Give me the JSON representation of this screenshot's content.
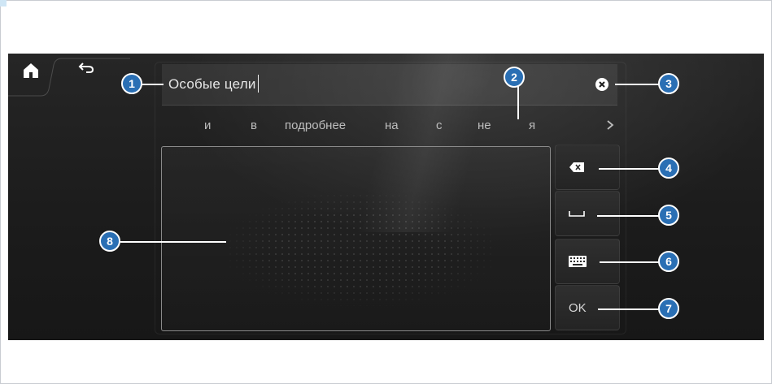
{
  "text_field": {
    "value": "Особые цели"
  },
  "suggestions": [
    {
      "label": "и"
    },
    {
      "label": "в"
    },
    {
      "label": "подробнее"
    },
    {
      "label": "на"
    },
    {
      "label": "с"
    },
    {
      "label": "не"
    },
    {
      "label": "я"
    }
  ],
  "side_buttons": {
    "ok_label": "OK"
  },
  "callouts": [
    "1",
    "2",
    "3",
    "4",
    "5",
    "6",
    "7",
    "8"
  ],
  "icons": {
    "home": "home-icon",
    "back": "back-arrow-icon",
    "clear": "clear-x-icon",
    "more": "chevron-right-icon",
    "backspace": "backspace-icon",
    "space": "space-icon",
    "keyboard": "keyboard-icon"
  },
  "colors": {
    "callout": "#2a6fb4",
    "screen_bg": "#1e1e1e",
    "text": "#e6e6e6"
  }
}
